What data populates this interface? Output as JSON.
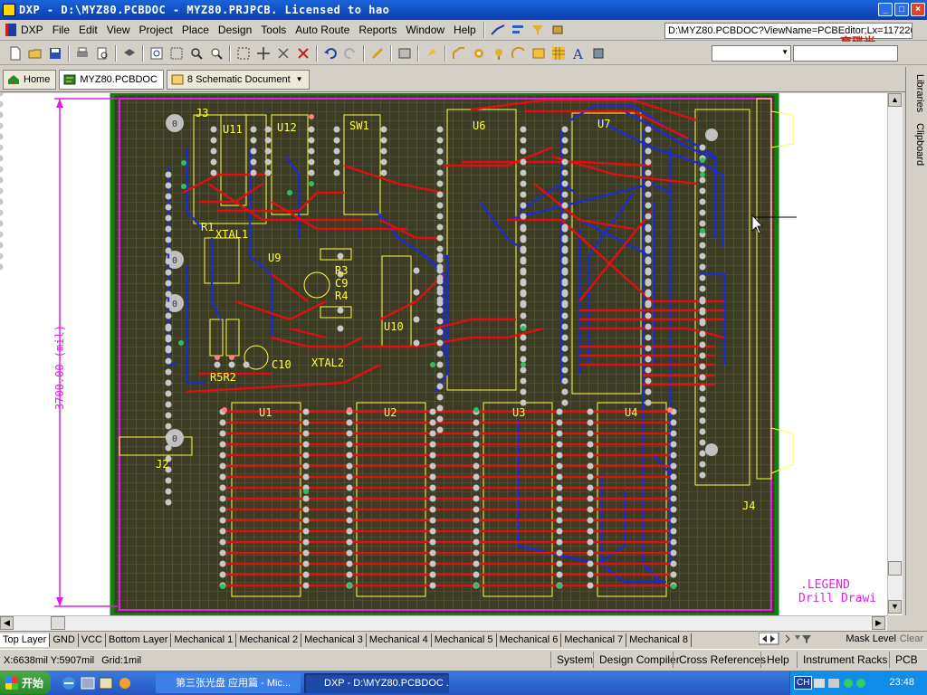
{
  "window": {
    "title": "DXP - D:\\MYZ80.PCBDOC - MYZ80.PRJPCB. Licensed to hao"
  },
  "menu": {
    "items": [
      "DXP",
      "File",
      "Edit",
      "View",
      "Project",
      "Place",
      "Design",
      "Tools",
      "Auto Route",
      "Reports",
      "Window",
      "Help"
    ]
  },
  "address": {
    "value": "D:\\MYZ80.PCBDOC?ViewName=PCBEditor;Lx=117226"
  },
  "logo": {
    "text": "育碟光"
  },
  "tabs": {
    "home": "Home",
    "pcb": "MYZ80.PCBDOC",
    "schematic": "8 Schematic Document"
  },
  "side_panels": [
    "Libraries",
    "Clipboard"
  ],
  "board": {
    "dimension_label": "3700.00 (mil)",
    "legend": ".LEGEND",
    "drill": "Drill Drawi",
    "components": {
      "j3": "J3",
      "u11": "U11",
      "u12": "U12",
      "sw1": "SW1",
      "u6": "U6",
      "u7": "U7",
      "r1": "R1",
      "xtal1": "XTAL1",
      "u9": "U9",
      "r3": "R3",
      "c9": "C9",
      "r4": "R4",
      "u10": "U10",
      "r5r2": "R5R2",
      "c10": "C10",
      "xtal2": "XTAL2",
      "u1": "U1",
      "u2": "U2",
      "u3": "U3",
      "u4": "U4",
      "j2": "J2",
      "j4": "J4"
    },
    "hole_labels": [
      "0",
      "0",
      "0",
      "0"
    ]
  },
  "layers": [
    "Top Layer",
    "GND",
    "VCC",
    "Bottom Layer",
    "Mechanical 1",
    "Mechanical 2",
    "Mechanical 3",
    "Mechanical 4",
    "Mechanical 5",
    "Mechanical 6",
    "Mechanical 7",
    "Mechanical 8"
  ],
  "layer_controls": {
    "mask": "Mask Level",
    "clear": "Clear"
  },
  "status": {
    "coords": "X:6638mil Y:5907mil",
    "grid": "Grid:1mil",
    "buttons": [
      "System",
      "Design Compiler",
      "Cross References",
      "Help",
      "Instrument Racks",
      "PCB"
    ]
  },
  "taskbar": {
    "start": "开始",
    "tasks": [
      "第三张光盘 应用篇 - Mic...",
      "DXP - D:\\MYZ80.PCBDOC ..."
    ],
    "lang": "CH",
    "time": "23:48"
  },
  "colors": {
    "board": "#3c3b24",
    "track_top": "#e01010",
    "track_bottom": "#1a2cd8",
    "silkscreen": "#ffff40",
    "keepout": "#e020e0",
    "board_edge": "#108010"
  }
}
